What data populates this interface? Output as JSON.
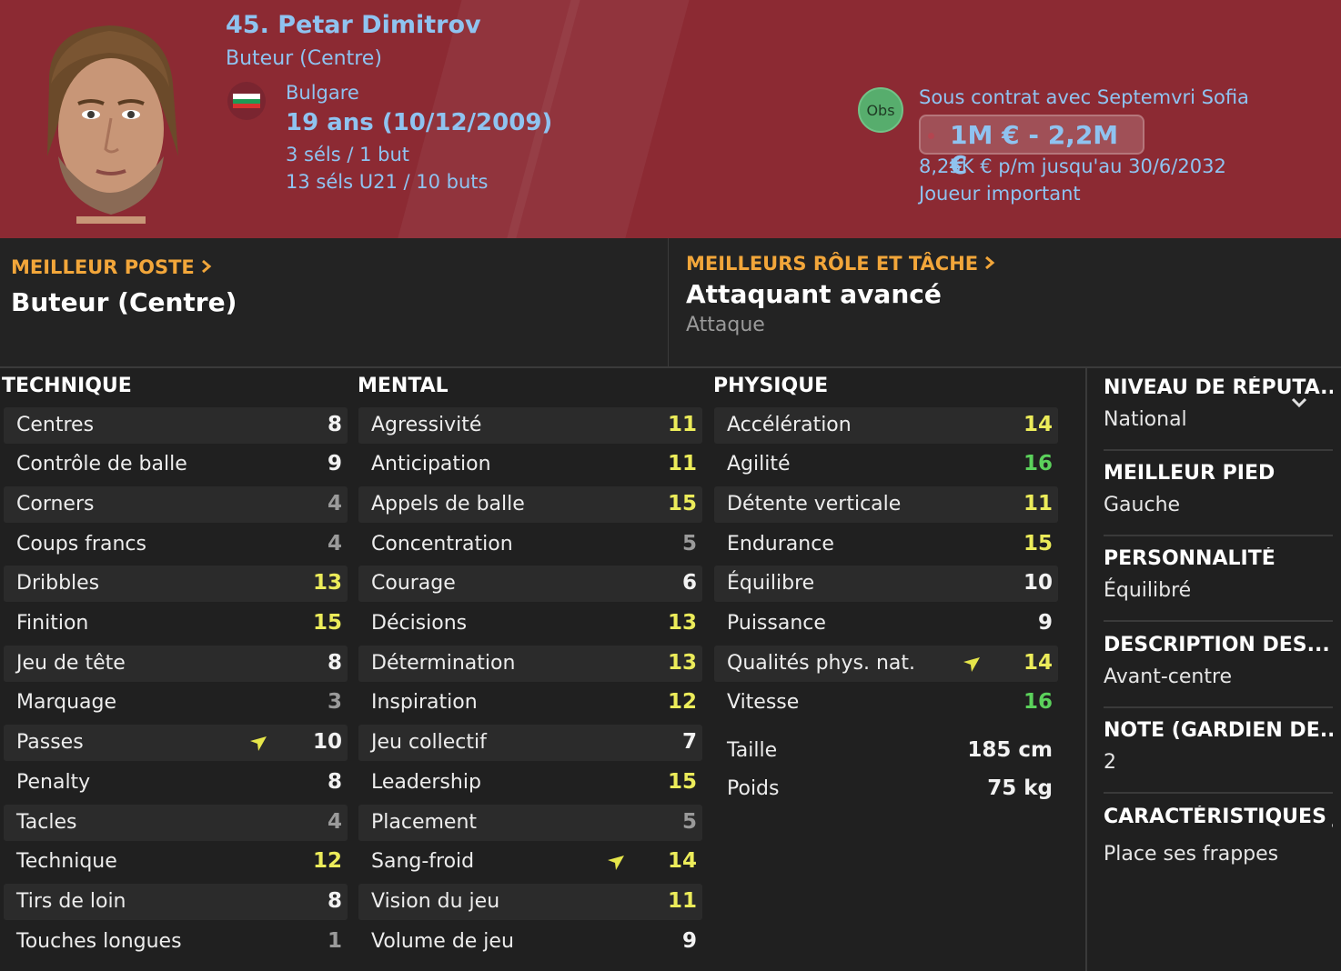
{
  "header": {
    "name": "45. Petar Dimitrov",
    "position": "Buteur (Centre)",
    "nationality": "Bulgare",
    "age": "19 ans (10/12/2009)",
    "caps": "3 séls / 1 but",
    "caps_u21": "13 séls U21 / 10 buts",
    "obs_badge": "Obs",
    "contract": "Sous contrat avec Septemvri Sofia",
    "value_range": "1M € - 2,2M €",
    "wage": "8,25K € p/m jusqu'au 30/6/2032",
    "squad_status": "Joueur important",
    "colors": {
      "header_bg": "#8c2a33",
      "text_blue": "#8fc3f0",
      "accent_orange": "#f2a63a"
    }
  },
  "best_position": {
    "label": "MEILLEUR POSTE",
    "value": "Buteur (Centre)"
  },
  "best_role": {
    "label": "MEILLEURS RÔLE ET TÂCHE",
    "value": "Attaquant avancé",
    "duty": "Attaque"
  },
  "technique": {
    "title": "TECHNIQUE",
    "attrs": [
      {
        "name": "Centres",
        "value": "8"
      },
      {
        "name": "Contrôle de balle",
        "value": "9"
      },
      {
        "name": "Corners",
        "value": "4"
      },
      {
        "name": "Coups francs",
        "value": "4"
      },
      {
        "name": "Dribbles",
        "value": "13"
      },
      {
        "name": "Finition",
        "value": "15"
      },
      {
        "name": "Jeu de tête",
        "value": "8"
      },
      {
        "name": "Marquage",
        "value": "3"
      },
      {
        "name": "Passes",
        "value": "10"
      },
      {
        "name": "Penalty",
        "value": "8"
      },
      {
        "name": "Tacles",
        "value": "4"
      },
      {
        "name": "Technique",
        "value": "12"
      },
      {
        "name": "Tirs de loin",
        "value": "8"
      },
      {
        "name": "Touches longues",
        "value": "1"
      }
    ]
  },
  "mental": {
    "title": "MENTAL",
    "attrs": [
      {
        "name": "Agressivité",
        "value": "11"
      },
      {
        "name": "Anticipation",
        "value": "11"
      },
      {
        "name": "Appels de balle",
        "value": "15"
      },
      {
        "name": "Concentration",
        "value": "5"
      },
      {
        "name": "Courage",
        "value": "6"
      },
      {
        "name": "Décisions",
        "value": "13"
      },
      {
        "name": "Détermination",
        "value": "13"
      },
      {
        "name": "Inspiration",
        "value": "12"
      },
      {
        "name": "Jeu collectif",
        "value": "7"
      },
      {
        "name": "Leadership",
        "value": "15"
      },
      {
        "name": "Placement",
        "value": "5"
      },
      {
        "name": "Sang-froid",
        "value": "14"
      },
      {
        "name": "Vision du jeu",
        "value": "11"
      },
      {
        "name": "Volume de jeu",
        "value": "9"
      }
    ]
  },
  "physique": {
    "title": "PHYSIQUE",
    "attrs": [
      {
        "name": "Accélération",
        "value": "14"
      },
      {
        "name": "Agilité",
        "value": "16"
      },
      {
        "name": "Détente verticale",
        "value": "11"
      },
      {
        "name": "Endurance",
        "value": "15"
      },
      {
        "name": "Équilibre",
        "value": "10"
      },
      {
        "name": "Puissance",
        "value": "9"
      },
      {
        "name": "Qualités phys. nat.",
        "value": "14"
      },
      {
        "name": "Vitesse",
        "value": "16"
      }
    ],
    "height_label": "Taille",
    "height": "185 cm",
    "weight_label": "Poids",
    "weight": "75 kg"
  },
  "info_panel": {
    "reputation_title": "NIVEAU DE RÉPUTA...",
    "reputation": "National",
    "foot_title": "MEILLEUR PIED",
    "foot": "Gauche",
    "personality_title": "PERSONNALITÉ",
    "personality": "Équilibré",
    "description_title": "DESCRIPTION DES...",
    "description": "Avant-centre",
    "gk_title": "NOTE (GARDIEN DE...",
    "gk_rating": "2",
    "traits_title": "CARACTÉRISTIQUES J",
    "traits": "Place ses frappes"
  },
  "icons": {
    "improvement": "arrow-up-right-icon",
    "expand": "chevron-down-icon",
    "link": "chevron-right-icon"
  }
}
